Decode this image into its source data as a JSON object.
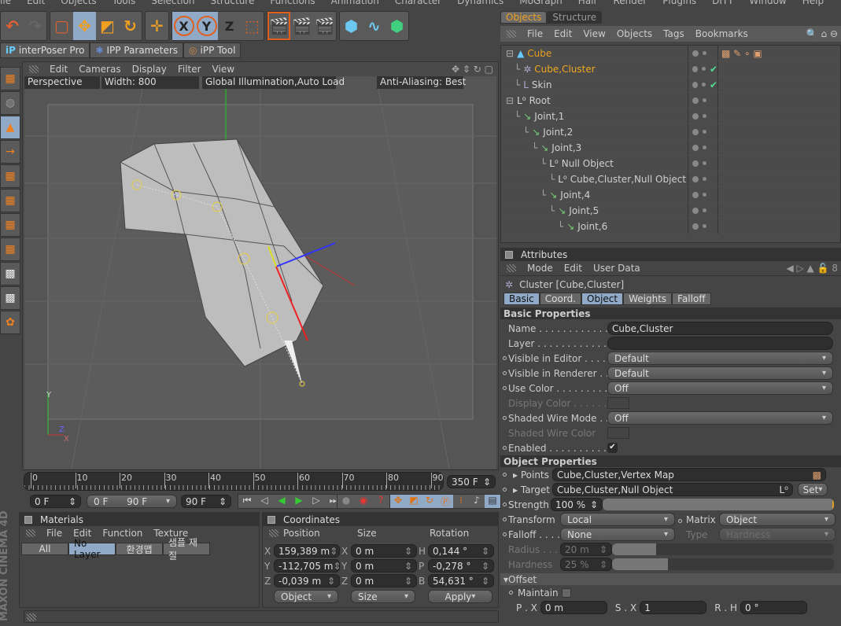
{
  "menubar": [
    "ile",
    "Edit",
    "Objects",
    "Tools",
    "Selection",
    "Structure",
    "Functions",
    "Animation",
    "Character",
    "Dynamics",
    "MoGraph",
    "Hair",
    "Render",
    "Plugins",
    "DITT",
    "Window",
    "Help"
  ],
  "toolbar": {
    "buttons": [
      "undo-icon",
      "redo-icon",
      "live-selection-icon",
      "move-icon",
      "scale-icon",
      "rotate-icon",
      "world-axis-icon",
      "x-axis-icon",
      "y-axis-icon",
      "z-axis-icon",
      "coordinate-system-icon",
      "render-view-icon",
      "render-picture-viewer-icon",
      "render-settings-icon",
      "cube-primitive-icon",
      "spline-icon",
      "nurbs-icon"
    ],
    "z_label": "Z",
    "x_label": "X",
    "y_label": "Y"
  },
  "plugin_tabs": [
    "interPoser Pro",
    "IPP Parameters",
    "iPP Tool"
  ],
  "viewport": {
    "menu": [
      "Edit",
      "Cameras",
      "Display",
      "Filter",
      "View"
    ],
    "camera": "Perspective",
    "width": "Width:  800",
    "gi": "Global Illumination,Auto Load",
    "aa": "Anti-Aliasing: Best",
    "axis": {
      "y": "Y",
      "z": "Z",
      "x": "X"
    }
  },
  "timeline": {
    "ticks": [
      "0",
      "10",
      "20",
      "30",
      "40",
      "50",
      "60",
      "70",
      "80",
      "90"
    ],
    "end_frame": "350 F",
    "start": "0 F",
    "range_start": "0 F",
    "range_end": "90 F",
    "current_end": "90 F"
  },
  "materials": {
    "title": "Materials",
    "menu": [
      "File",
      "Edit",
      "Function",
      "Texture"
    ],
    "tabs": [
      "All",
      "No Layer",
      "환경맵",
      "샘플 재질"
    ],
    "active_tab": "No Layer"
  },
  "coordinates": {
    "title": "Coordinates",
    "headers": [
      "Position",
      "Size",
      "Rotation"
    ],
    "rows": [
      {
        "pl": "X",
        "p": "159,389 m",
        "sl": "X",
        "s": "0 m",
        "rl": "H",
        "r": "0,144 °"
      },
      {
        "pl": "Y",
        "p": "-112,705 m",
        "sl": "Y",
        "s": "0 m",
        "rl": "P",
        "r": "-0,278 °"
      },
      {
        "pl": "Z",
        "p": "-0,039 m",
        "sl": "Z",
        "s": "0 m",
        "rl": "B",
        "r": "54,631 °"
      }
    ],
    "mode": "Object",
    "size_mode": "Size",
    "apply": "Apply"
  },
  "brand": "MAXON CINEMA 4D",
  "objects": {
    "tabs": [
      "Objects",
      "Structure"
    ],
    "active_tab": "Objects",
    "menu": [
      "File",
      "Edit",
      "View",
      "Objects",
      "Tags",
      "Bookmarks"
    ],
    "items": [
      {
        "name": "Cube",
        "depth": 0,
        "color": "#e8a020"
      },
      {
        "name": "Cube,Cluster",
        "depth": 1,
        "color": "#f0a820",
        "check": true
      },
      {
        "name": "Skin",
        "depth": 1,
        "check": true
      },
      {
        "name": "Root",
        "depth": 0
      },
      {
        "name": "Joint,1",
        "depth": 1
      },
      {
        "name": "Joint,2",
        "depth": 2
      },
      {
        "name": "Joint,3",
        "depth": 3
      },
      {
        "name": "Null Object",
        "depth": 4
      },
      {
        "name": "Cube,Cluster,Null Object",
        "depth": 5
      },
      {
        "name": "Joint,4",
        "depth": 4
      },
      {
        "name": "Joint,5",
        "depth": 5
      },
      {
        "name": "Joint,6",
        "depth": 6
      }
    ]
  },
  "attributes": {
    "title": "Attributes",
    "menu": [
      "Mode",
      "Edit",
      "User Data"
    ],
    "object_title": "Cluster [Cube,Cluster]",
    "tabs": [
      "Basic",
      "Coord.",
      "Object",
      "Weights",
      "Falloff"
    ],
    "active_tabs": [
      "Basic",
      "Object"
    ],
    "basic_title": "Basic Properties",
    "basic": [
      {
        "label": "Name . . . . . . . . . . . . . .",
        "type": "text",
        "value": "Cube,Cluster"
      },
      {
        "label": "Layer . . . . . . . . . . . . . .",
        "type": "layer",
        "value": ""
      },
      {
        "label": "Visible in Editor . . . . .",
        "type": "drop",
        "value": "Default",
        "anim": true
      },
      {
        "label": "Visible in Renderer . .",
        "type": "drop",
        "value": "Default",
        "anim": true
      },
      {
        "label": "Use Color . . . . . . . . . .",
        "type": "drop",
        "value": "Off",
        "anim": true
      },
      {
        "label": "Display Color . . . . . .",
        "type": "color",
        "value": "",
        "dim": true
      },
      {
        "label": "Shaded Wire Mode . .",
        "type": "drop",
        "value": "Off",
        "anim": true
      },
      {
        "label": "Shaded Wire Color",
        "type": "color",
        "value": "",
        "dim": true
      },
      {
        "label": "Enabled . . . . . . . . . . . .",
        "type": "check",
        "value": "✔",
        "anim": true
      }
    ],
    "object_title2": "Object Properties",
    "points_label": "Points",
    "points": "Cube,Cluster,Vertex Map",
    "target_label": "Target",
    "target": "Cube,Cluster,Null Object",
    "set": "Set",
    "strength_label": "Strength",
    "strength": "100 %",
    "strength_value": 100,
    "transform_label": "Transform",
    "transform": "Local",
    "matrix_label": "Matrix",
    "matrix": "Object",
    "falloff_label": "Falloff . . . .",
    "falloff": "None",
    "type_label": "Type",
    "type": "Hardness",
    "radius_label": "Radius . . .",
    "radius": "20 m",
    "hardness_label": "Hardness",
    "hardness": "25 %",
    "offset_title": "Offset",
    "maintain_label": "Maintain",
    "offset": [
      {
        "label": "P . X",
        "value": "0 m"
      },
      {
        "label": "S . X",
        "value": "1"
      },
      {
        "label": "R . H",
        "value": "0 °"
      }
    ]
  }
}
